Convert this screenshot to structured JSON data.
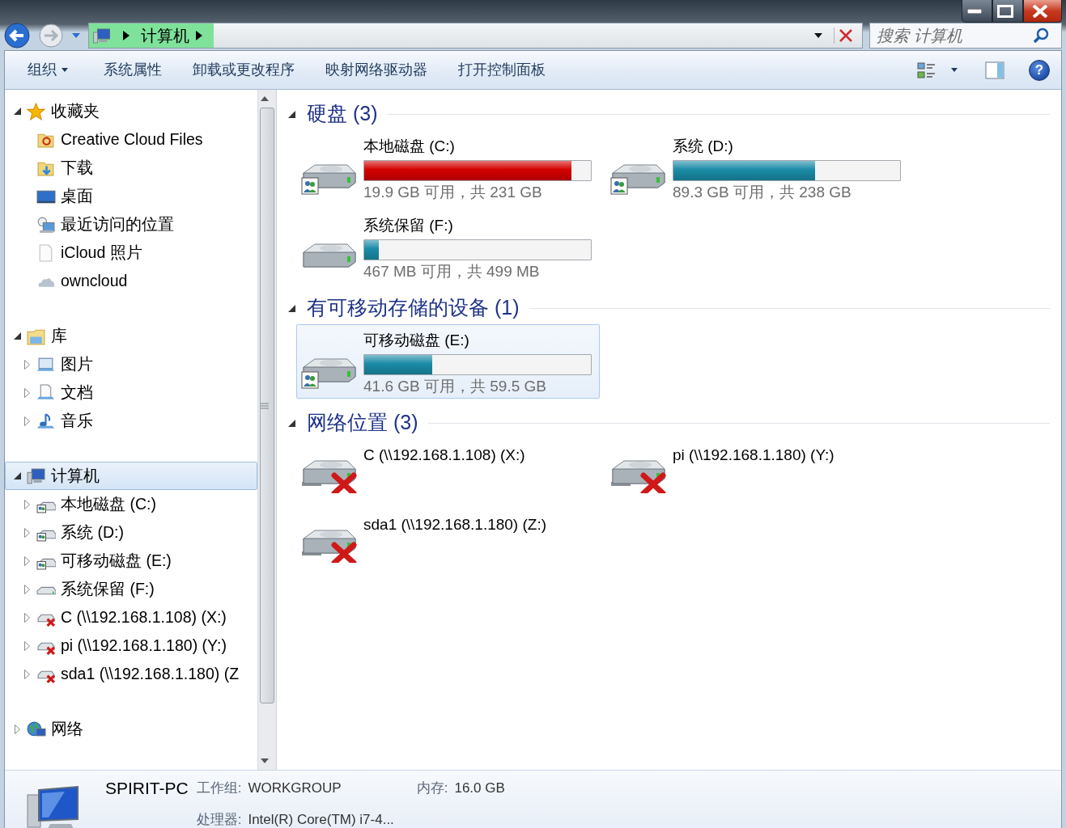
{
  "address_bar": {
    "crumbs": [
      "计算机"
    ]
  },
  "search": {
    "placeholder": "搜索 计算机"
  },
  "toolbar": [
    {
      "label": "组织",
      "dropdown": true
    },
    {
      "label": "系统属性",
      "dropdown": false
    },
    {
      "label": "卸载或更改程序",
      "dropdown": false
    },
    {
      "label": "映射网络驱动器",
      "dropdown": false
    },
    {
      "label": "打开控制面板",
      "dropdown": false
    }
  ],
  "help_button": {
    "label": "?"
  },
  "nav_tree": [
    {
      "label": "收藏夹",
      "kind": "favorites",
      "expanded": true,
      "selected": false,
      "children": [
        {
          "label": "Creative Cloud Files",
          "kind": "cloudfolder",
          "expandable": false,
          "selected": false
        },
        {
          "label": "下载",
          "kind": "downloads",
          "expandable": false,
          "selected": false
        },
        {
          "label": "桌面",
          "kind": "desktop",
          "expandable": false,
          "selected": false
        },
        {
          "label": "最近访问的位置",
          "kind": "recent",
          "expandable": false,
          "selected": false
        },
        {
          "label": "iCloud 照片",
          "kind": "file",
          "expandable": false,
          "selected": false
        },
        {
          "label": "owncloud",
          "kind": "cloud",
          "expandable": false,
          "selected": false
        }
      ]
    },
    {
      "label": "库",
      "kind": "library",
      "expanded": true,
      "selected": false,
      "children": [
        {
          "label": "图片",
          "kind": "pictures",
          "expandable": true,
          "selected": false
        },
        {
          "label": "文档",
          "kind": "documents",
          "expandable": true,
          "selected": false
        },
        {
          "label": "音乐",
          "kind": "music",
          "expandable": true,
          "selected": false
        }
      ]
    },
    {
      "label": "计算机",
      "kind": "computer",
      "expanded": true,
      "selected": true,
      "children": [
        {
          "label": "本地磁盘 (C:)",
          "kind": "shared",
          "expandable": true,
          "selected": false
        },
        {
          "label": "系统 (D:)",
          "kind": "shared",
          "expandable": true,
          "selected": false
        },
        {
          "label": "可移动磁盘 (E:)",
          "kind": "shared",
          "expandable": true,
          "selected": false
        },
        {
          "label": "系统保留 (F:)",
          "kind": "local",
          "expandable": true,
          "selected": false
        },
        {
          "label": "C (\\\\192.168.1.108) (X:)",
          "kind": "networkdrive",
          "expandable": true,
          "selected": false
        },
        {
          "label": "pi (\\\\192.168.1.180) (Y:)",
          "kind": "networkdrive",
          "expandable": true,
          "selected": false
        },
        {
          "label": "sda1 (\\\\192.168.1.180) (Z",
          "kind": "networkdrive",
          "expandable": true,
          "selected": false
        }
      ]
    },
    {
      "label": "网络",
      "kind": "network",
      "expanded": false,
      "selected": false
    }
  ],
  "groups": [
    {
      "title": "硬盘 (3)",
      "expanded": true,
      "items": [
        {
          "kind": "shared",
          "name": "本地磁盘 (C:)",
          "level": 0.914,
          "usage": "19.9 GB 可用，共 231 GB",
          "color": "#d40000",
          "selected": false
        },
        {
          "kind": "shared",
          "name": "系统 (D:)",
          "level": 0.625,
          "usage": "89.3 GB 可用，共 238 GB",
          "color": "#1a8ba6",
          "selected": false
        },
        {
          "kind": "local",
          "name": "系统保留 (F:)",
          "level": 0.064,
          "usage": "467 MB 可用，共 499 MB",
          "color": "#1a8ba6",
          "selected": false
        }
      ]
    },
    {
      "title": "有可移动存储的设备 (1)",
      "expanded": true,
      "items": [
        {
          "kind": "shared",
          "name": "可移动磁盘 (E:)",
          "level": 0.301,
          "usage": "41.6 GB 可用，共 59.5 GB",
          "color": "#1a8ba6",
          "selected": true
        }
      ]
    },
    {
      "title": "网络位置 (3)",
      "expanded": true,
      "items": [
        {
          "kind": "networkdrive",
          "name": "C (\\\\192.168.1.108) (X:)",
          "selected": false
        },
        {
          "kind": "networkdrive",
          "name": "pi (\\\\192.168.1.180) (Y:)",
          "selected": false
        },
        {
          "kind": "networkdrive",
          "name": "sda1 (\\\\192.168.1.180) (Z:)",
          "selected": false
        }
      ]
    }
  ],
  "details": {
    "name": "SPIRIT-PC",
    "fields": [
      {
        "label": "工作组:",
        "value": "WORKGROUP"
      },
      {
        "label": "内存:",
        "value": "16.0 GB"
      },
      {
        "label": "处理器:",
        "value": "Intel(R) Core(TM) i7-4..."
      }
    ]
  }
}
